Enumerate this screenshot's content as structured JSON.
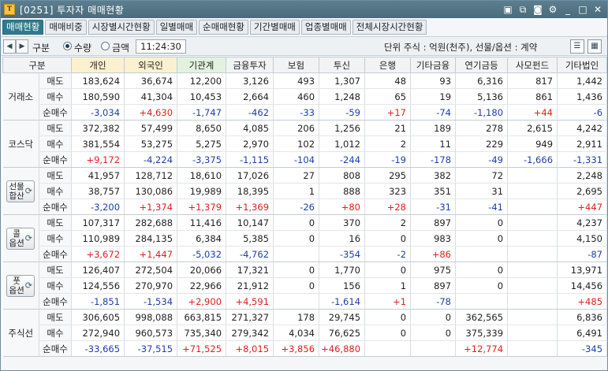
{
  "window": {
    "title": "[0251] 투자자 매매현황",
    "app_icon": "T",
    "controls": [
      "window-icon",
      "copy-icon",
      "camera-icon",
      "gear-icon",
      "minimize-icon",
      "maximize-icon",
      "close-icon"
    ]
  },
  "tabs": [
    {
      "label": "매매현황",
      "active": true
    },
    {
      "label": "매매비중",
      "active": false
    },
    {
      "label": "시장별시간현황",
      "active": false
    },
    {
      "label": "일별매매",
      "active": false
    },
    {
      "label": "순매매현황",
      "active": false
    },
    {
      "label": "기간별매매",
      "active": false
    },
    {
      "label": "업종별매매",
      "active": false
    },
    {
      "label": "전체시장시간현황",
      "active": false
    }
  ],
  "toolbar": {
    "type_label": "구분",
    "qty_label": "수량",
    "amount_label": "금액",
    "selected": "qty",
    "time": "11:24:30",
    "unit_text": "단위 주식 : 억원(천주), 선물/옵션 : 계약"
  },
  "columns": [
    "구분",
    "개인",
    "외국인",
    "기관계",
    "금융투자",
    "보험",
    "투신",
    "은행",
    "기타금융",
    "연기금등",
    "사모펀드",
    "기타법인"
  ],
  "row_labels": [
    "매도",
    "매수",
    "순매수"
  ],
  "colors": {
    "positive": "#e0201c",
    "negative": "#1c3ea8",
    "accent": "#2f7a8c"
  },
  "groups": [
    {
      "name": "거래소",
      "button": false,
      "rows": [
        [
          "183,624",
          "36,674",
          "12,200",
          "3,126",
          "493",
          "1,307",
          "48",
          "93",
          "6,316",
          "817",
          "1,442"
        ],
        [
          "180,590",
          "41,304",
          "10,453",
          "2,664",
          "460",
          "1,248",
          "65",
          "19",
          "5,136",
          "861",
          "1,436"
        ],
        [
          "-3,034",
          "+4,630",
          "-1,747",
          "-462",
          "-33",
          "-59",
          "+17",
          "-74",
          "-1,180",
          "+44",
          "-6"
        ]
      ]
    },
    {
      "name": "코스닥",
      "button": false,
      "rows": [
        [
          "372,382",
          "57,499",
          "8,650",
          "4,085",
          "206",
          "1,256",
          "21",
          "189",
          "278",
          "2,615",
          "4,242"
        ],
        [
          "381,554",
          "53,275",
          "5,275",
          "2,970",
          "102",
          "1,012",
          "2",
          "11",
          "229",
          "949",
          "2,911"
        ],
        [
          "+9,172",
          "-4,224",
          "-3,375",
          "-1,115",
          "-104",
          "-244",
          "-19",
          "-178",
          "-49",
          "-1,666",
          "-1,331"
        ]
      ]
    },
    {
      "name_lines": [
        "선물",
        "합산"
      ],
      "button": true,
      "rows": [
        [
          "41,957",
          "128,712",
          "18,610",
          "17,026",
          "27",
          "808",
          "295",
          "382",
          "72",
          "",
          "2,248"
        ],
        [
          "38,757",
          "130,086",
          "19,989",
          "18,395",
          "1",
          "888",
          "323",
          "351",
          "31",
          "",
          "2,695"
        ],
        [
          "-3,200",
          "+1,374",
          "+1,379",
          "+1,369",
          "-26",
          "+80",
          "+28",
          "-31",
          "-41",
          "",
          "+447"
        ]
      ]
    },
    {
      "name_lines": [
        "콜",
        "옵션"
      ],
      "button": true,
      "rows": [
        [
          "107,317",
          "282,688",
          "11,416",
          "10,147",
          "0",
          "370",
          "2",
          "897",
          "0",
          "",
          "4,237"
        ],
        [
          "110,989",
          "284,135",
          "6,384",
          "5,385",
          "0",
          "16",
          "0",
          "983",
          "0",
          "",
          "4,150"
        ],
        [
          "+3,672",
          "+1,447",
          "-5,032",
          "-4,762",
          "",
          "-354",
          "-2",
          "+86",
          "",
          "",
          "-87"
        ]
      ]
    },
    {
      "name_lines": [
        "풋",
        "옵션"
      ],
      "button": true,
      "rows": [
        [
          "126,407",
          "272,504",
          "20,066",
          "17,321",
          "0",
          "1,770",
          "0",
          "975",
          "0",
          "",
          "13,971"
        ],
        [
          "124,556",
          "270,970",
          "22,966",
          "21,912",
          "0",
          "156",
          "1",
          "897",
          "0",
          "",
          "14,456"
        ],
        [
          "-1,851",
          "-1,534",
          "+2,900",
          "+4,591",
          "",
          "-1,614",
          "+1",
          "-78",
          "",
          "",
          "+485"
        ]
      ]
    },
    {
      "name": "주식선",
      "button": false,
      "rows": [
        [
          "306,605",
          "998,088",
          "663,815",
          "271,327",
          "178",
          "29,745",
          "0",
          "0",
          "362,565",
          "",
          "6,836"
        ],
        [
          "272,940",
          "960,573",
          "735,340",
          "279,342",
          "4,034",
          "76,625",
          "0",
          "0",
          "375,339",
          "",
          "6,491"
        ],
        [
          "-33,665",
          "-37,515",
          "+71,525",
          "+8,015",
          "+3,856",
          "+46,880",
          "",
          "",
          "+12,774",
          "",
          "-345"
        ]
      ]
    }
  ]
}
